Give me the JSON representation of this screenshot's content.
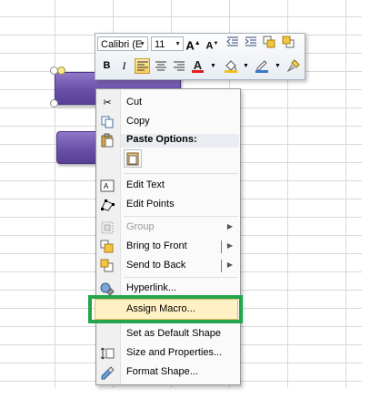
{
  "minibar": {
    "font_name": "Calibri (E",
    "font_size": "11",
    "grow_icon": "A",
    "shrink_icon": "A",
    "bold": "B",
    "italic": "I",
    "font_color": "A"
  },
  "menu": {
    "cut": "Cut",
    "copy": "Copy",
    "paste_options": "Paste Options:",
    "edit_text": "Edit Text",
    "edit_points": "Edit Points",
    "group": "Group",
    "bring_to_front": "Bring to Front",
    "send_to_back": "Send to Back",
    "hyperlink": "Hyperlink...",
    "assign_macro": "Assign Macro...",
    "set_default": "Set as Default Shape",
    "size_properties": "Size and Properties...",
    "format_shape": "Format Shape..."
  },
  "colors": {
    "highlight": "#23a64b",
    "shape": "#6b50a8",
    "hover": "#fff1c4"
  },
  "icons": [
    "scissors-icon",
    "copy-icon",
    "paste-icon",
    "edit-text-icon",
    "edit-points-icon",
    "group-icon",
    "bring-front-icon",
    "send-back-icon",
    "hyperlink-icon",
    "macro-icon",
    "properties-icon",
    "format-shape-icon"
  ]
}
